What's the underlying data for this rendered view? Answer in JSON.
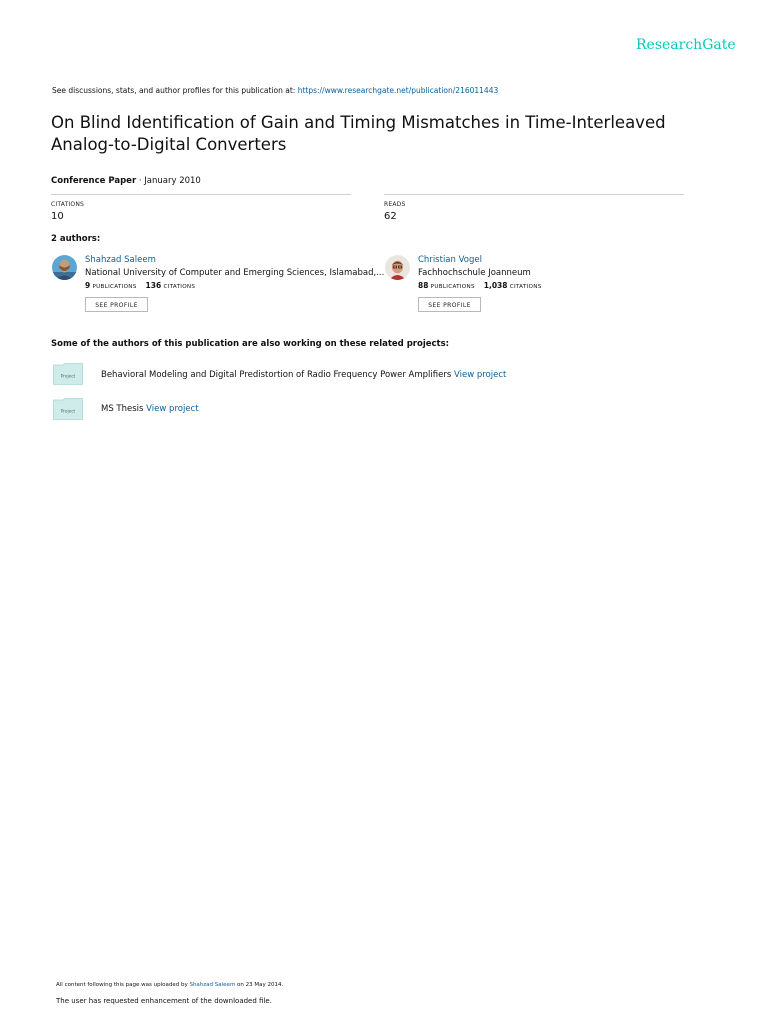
{
  "header": {
    "logo": "ResearchGate",
    "discussion_prefix": "See discussions, stats, and author profiles for this publication at: ",
    "publication_url": "https://www.researchgate.net/publication/216011443"
  },
  "publication": {
    "title_line1": "On Blind Identification of Gain and Timing Mismatches in Time-Interleaved",
    "title_line2": "Analog-to-Digital Converters",
    "type": "Conference Paper",
    "date_sep": " · ",
    "date": "January 2010"
  },
  "stats": {
    "citations_label": "CITATIONS",
    "citations_value": "10",
    "reads_label": "READS",
    "reads_value": "62"
  },
  "authors_heading": "2 authors:",
  "authors": [
    {
      "name": "Shahzad Saleem",
      "institution": "National University of Computer and Emerging Sciences, Islamabad,...",
      "publications": "9",
      "publications_label": "PUBLICATIONS",
      "citations": "136",
      "citations_label": "CITATIONS",
      "button": "SEE PROFILE"
    },
    {
      "name": "Christian Vogel",
      "institution": "Fachhochschule Joanneum",
      "publications": "88",
      "publications_label": "PUBLICATIONS",
      "citations": "1,038",
      "citations_label": "CITATIONS",
      "button": "SEE PROFILE"
    }
  ],
  "projects_heading": "Some of the authors of this publication are also working on these related projects:",
  "projects": [
    {
      "icon_label": "Project",
      "name": "Behavioral Modeling and Digital Predistortion of Radio Frequency Power Amplifiers",
      "link": "View project"
    },
    {
      "icon_label": "Project",
      "name": "MS Thesis",
      "link": "View project"
    }
  ],
  "footer": {
    "upload_prefix": "All content following this page was uploaded by ",
    "uploader": "Shahzad Saleem",
    "upload_suffix": " on 23 May 2014.",
    "note": "The user has requested enhancement of the downloaded file."
  },
  "colors": {
    "brand": "#00ccbb",
    "link": "#0b5e98",
    "project_icon": "#cfecea"
  }
}
